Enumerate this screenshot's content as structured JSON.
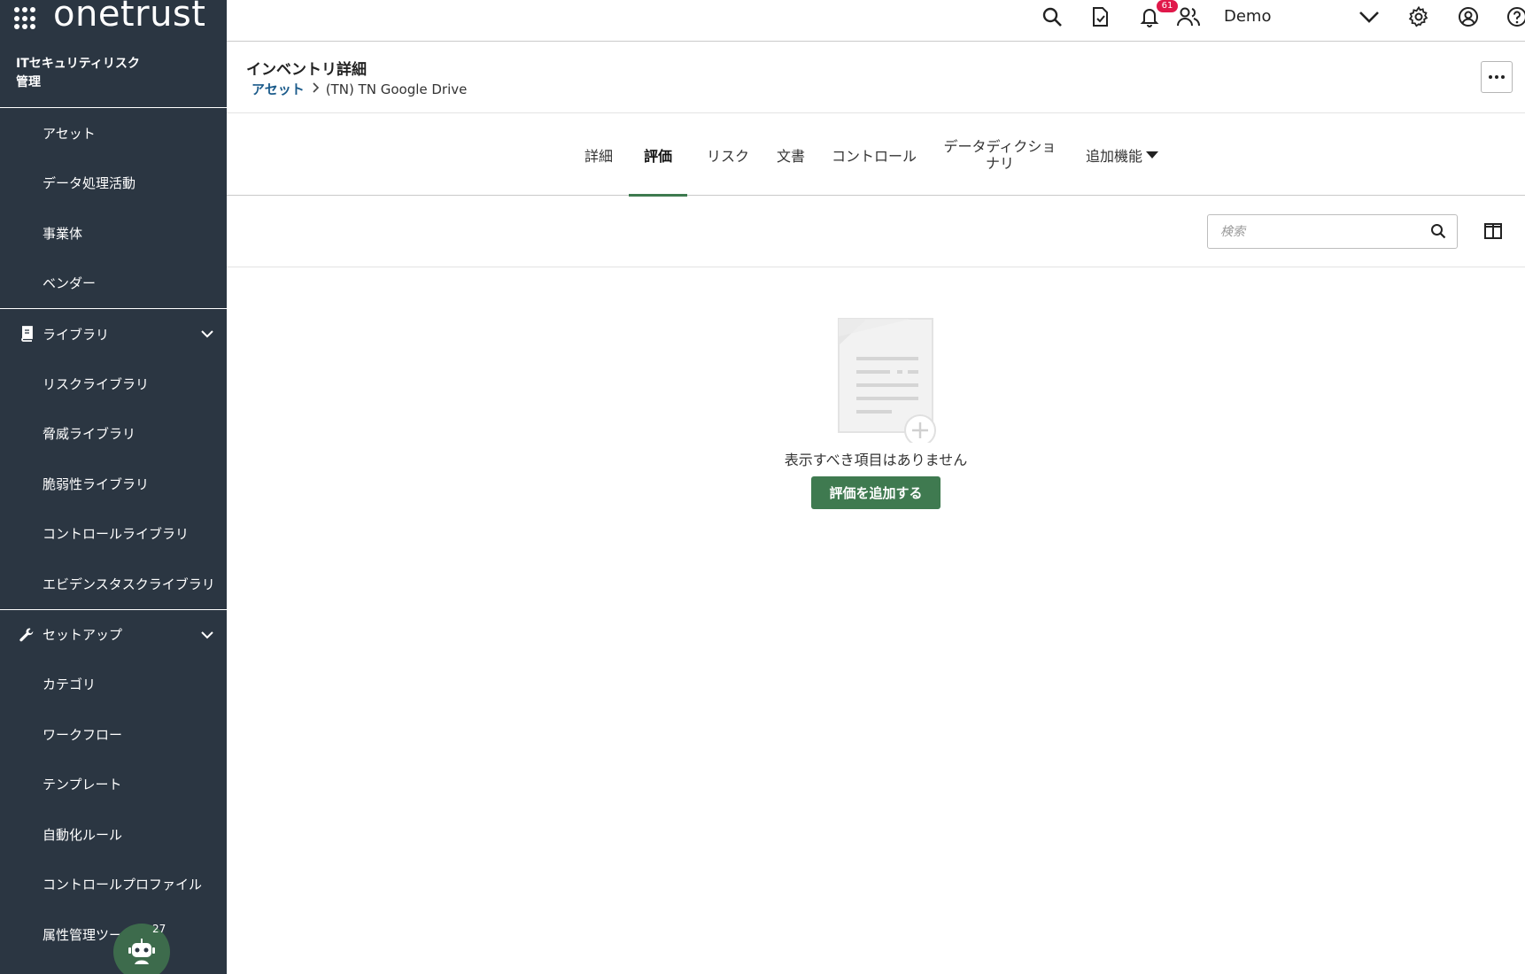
{
  "app": {
    "brand": "onetrust"
  },
  "sidebar": {
    "module_title": "ITセキュリティリスク管理",
    "top_items": [
      {
        "label": "アセット"
      },
      {
        "label": "データ処理活動"
      },
      {
        "label": "事業体"
      },
      {
        "label": "ベンダー"
      }
    ],
    "library_group": {
      "label": "ライブラリ",
      "items": [
        {
          "label": "リスクライブラリ"
        },
        {
          "label": "脅威ライブラリ"
        },
        {
          "label": "脆弱性ライブラリ"
        },
        {
          "label": "コントロールライブラリ"
        },
        {
          "label": "エビデンスタスクライブラリ"
        }
      ]
    },
    "setup_group": {
      "label": "セットアップ",
      "items": [
        {
          "label": "カテゴリ"
        },
        {
          "label": "ワークフロー"
        },
        {
          "label": "テンプレート"
        },
        {
          "label": "自動化ルール"
        },
        {
          "label": "コントロールプロファイル"
        },
        {
          "label": "属性管理ツー"
        }
      ]
    },
    "assistant_badge": "27"
  },
  "topbar": {
    "notification_count": "61",
    "user_name": "Demo"
  },
  "header": {
    "title": "インベントリ詳細",
    "breadcrumb_link": "アセット",
    "breadcrumb_current": "(TN) TN Google Drive"
  },
  "tabs": [
    {
      "label": "詳細"
    },
    {
      "label": "評価"
    },
    {
      "label": "リスク"
    },
    {
      "label": "文書"
    },
    {
      "label": "コントロール"
    },
    {
      "label": "データディクショナリ"
    },
    {
      "label": "追加機能"
    }
  ],
  "search": {
    "placeholder": "検索"
  },
  "empty_state": {
    "message": "表示すべき項目はありません",
    "button_label": "評価を追加する"
  },
  "colors": {
    "sidebar_bg": "#2b3642",
    "accent_green": "#3f7a50",
    "badge_red": "#e0184a",
    "link_blue": "#1a5a8a"
  }
}
